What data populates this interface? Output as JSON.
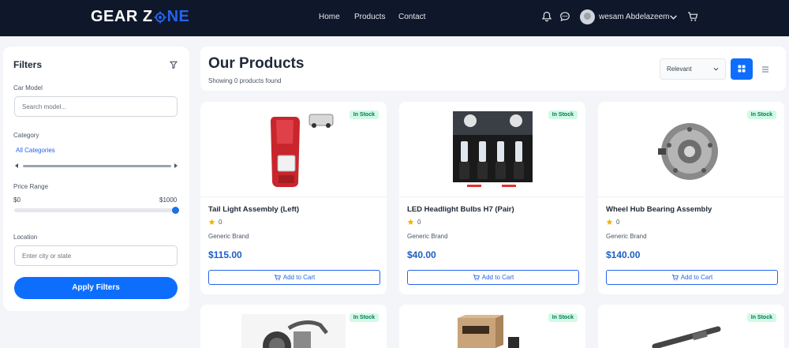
{
  "header": {
    "logo_part1": "GEAR Z",
    "logo_part2": "NE",
    "nav": [
      "Home",
      "Products",
      "Contact"
    ],
    "user_name": "wesam Abdelazeem"
  },
  "filters": {
    "title": "Filters",
    "car_model_label": "Car Model",
    "car_model_placeholder": "Search model...",
    "category_label": "Category",
    "category_selected": "All Categories",
    "price_label": "Price Range",
    "price_min": "$0",
    "price_max": "$1000",
    "price_value_fraction": 1.0,
    "location_label": "Location",
    "location_placeholder": "Enter city or state",
    "apply_label": "Apply Filters"
  },
  "products_header": {
    "title": "Our Products",
    "count_text": "Showing 0 products found",
    "sort_selected": "Relevant"
  },
  "products": [
    {
      "name": "Tail Light Assembly (Left)",
      "rating": "0",
      "brand": "Generic Brand",
      "price": "$115.00",
      "stock": "In Stock",
      "add_label": "Add to Cart"
    },
    {
      "name": "LED Headlight Bulbs H7 (Pair)",
      "rating": "0",
      "brand": "Generic Brand",
      "price": "$40.00",
      "stock": "In Stock",
      "add_label": "Add to Cart"
    },
    {
      "name": "Wheel Hub Bearing Assembly",
      "rating": "0",
      "brand": "Generic Brand",
      "price": "$140.00",
      "stock": "In Stock",
      "add_label": "Add to Cart"
    },
    {
      "stock": "In Stock"
    },
    {
      "stock": "In Stock"
    },
    {
      "stock": "In Stock"
    }
  ],
  "colors": {
    "header_bg": "#0f172a",
    "accent": "#0d6efd",
    "price": "#1d5fc2",
    "stock_bg": "#d1fae5",
    "stock_text": "#047857"
  }
}
